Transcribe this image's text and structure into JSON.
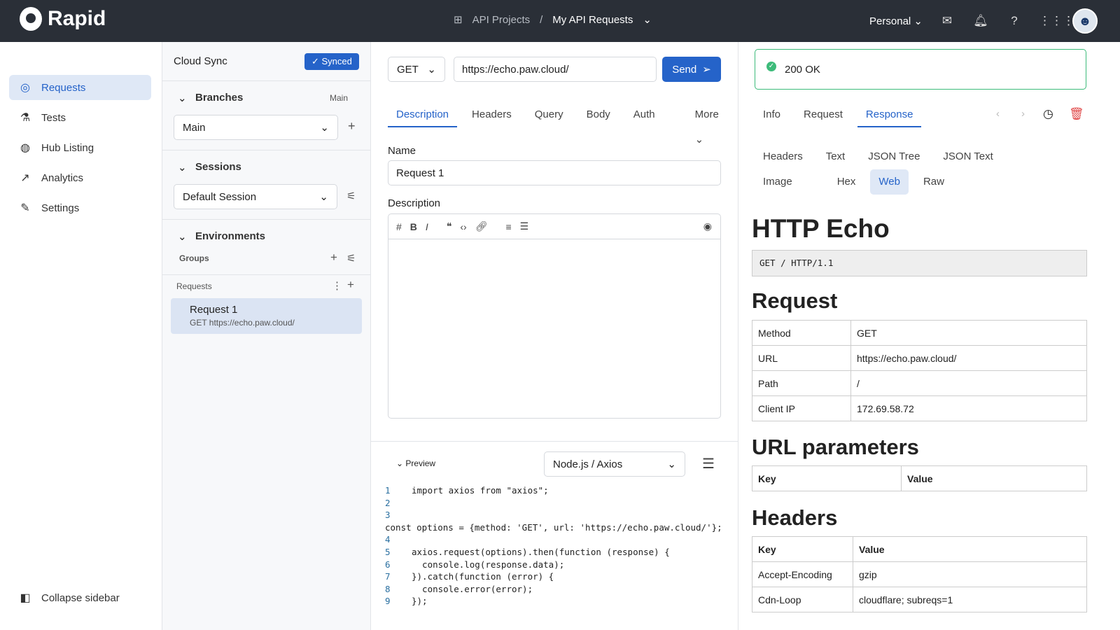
{
  "header": {
    "brand": "Rapid",
    "breadcrumb_root": "API Projects",
    "breadcrumb_sep": "/",
    "breadcrumb_current": "My API Requests",
    "workspace": "Personal"
  },
  "sidebar": {
    "items": [
      {
        "label": "Requests",
        "icon": "target-icon"
      },
      {
        "label": "Tests",
        "icon": "flask-icon"
      },
      {
        "label": "Hub Listing",
        "icon": "globe-icon"
      },
      {
        "label": "Analytics",
        "icon": "chart-icon"
      },
      {
        "label": "Settings",
        "icon": "pencil-icon"
      }
    ],
    "collapse": "Collapse sidebar"
  },
  "project": {
    "cloud_sync": "Cloud Sync",
    "synced": "Synced",
    "branches": "Branches",
    "branch_current": "Main",
    "branch_select": "Main",
    "sessions": "Sessions",
    "session_select": "Default Session",
    "environments": "Environments",
    "groups": "Groups",
    "requests": "Requests",
    "request_items": [
      {
        "name": "Request 1",
        "subtitle": "GET https://echo.paw.cloud/"
      }
    ]
  },
  "request": {
    "method": "GET",
    "url": "https://echo.paw.cloud/",
    "send": "Send",
    "tabs": [
      "Description",
      "Headers",
      "Query",
      "Body",
      "Auth",
      "More"
    ],
    "name_label": "Name",
    "name_value": "Request 1",
    "description_label": "Description",
    "preview": "Preview",
    "language": "Node.js / Axios",
    "code": [
      "import axios from \"axios\";",
      "",
      "const options = {method: 'GET', url: 'https://echo.paw.cloud/'};",
      "",
      "axios.request(options).then(function (response) {",
      "  console.log(response.data);",
      "}).catch(function (error) {",
      "  console.error(error);",
      "});"
    ]
  },
  "response": {
    "status": "200 OK",
    "status_color": "#3dbb7a",
    "tabs": [
      "Info",
      "Request",
      "Response"
    ],
    "subtabs": [
      "Headers",
      "Text",
      "JSON Tree",
      "JSON Text",
      "Image",
      "Hex",
      "Web",
      "Raw"
    ],
    "web": {
      "title": "HTTP Echo",
      "request_line": "GET / HTTP/1.1",
      "request_heading": "Request",
      "request_rows": [
        [
          "Method",
          "GET"
        ],
        [
          "URL",
          "https://echo.paw.cloud/"
        ],
        [
          "Path",
          "/"
        ],
        [
          "Client IP",
          "172.69.58.72"
        ]
      ],
      "url_params_heading": "URL parameters",
      "key": "Key",
      "value": "Value",
      "headers_heading": "Headers",
      "header_rows": [
        [
          "Accept-Encoding",
          "gzip"
        ],
        [
          "Cdn-Loop",
          "cloudflare; subreqs=1"
        ]
      ]
    }
  },
  "colors": {
    "accent": "#2563c9",
    "header_bg": "#2a2f37",
    "danger": "#e04848"
  }
}
